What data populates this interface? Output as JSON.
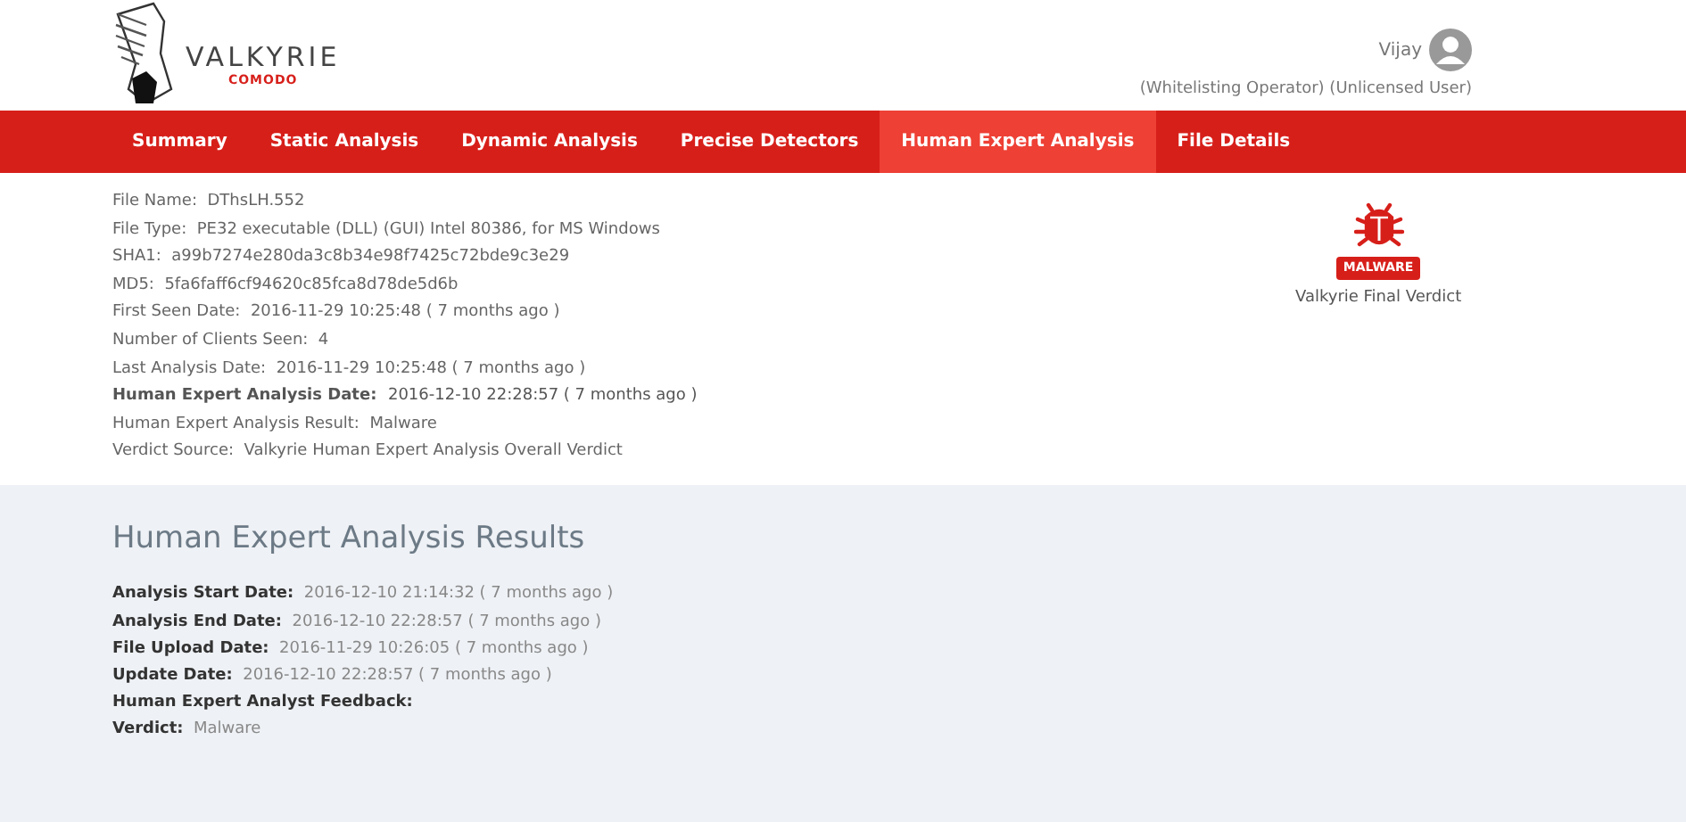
{
  "brand": {
    "name": "VALKYRIE",
    "sub": "COMODO"
  },
  "user": {
    "name": "Vijay",
    "roles": "(Whitelisting Operator) (Unlicensed User)"
  },
  "tabs": [
    {
      "label": "Summary",
      "selected": false
    },
    {
      "label": "Static Analysis",
      "selected": false
    },
    {
      "label": "Dynamic Analysis",
      "selected": false
    },
    {
      "label": "Precise Detectors",
      "selected": false
    },
    {
      "label": "Human Expert Analysis",
      "selected": true
    },
    {
      "label": "File Details",
      "selected": false
    }
  ],
  "file_info": [
    {
      "label": "File Name:",
      "value": "DThsLH.552",
      "emphasis": false
    },
    {
      "label": "File Type:",
      "value": "PE32 executable (DLL) (GUI) Intel 80386, for MS Windows",
      "emphasis": false
    },
    {
      "label": "SHA1:",
      "value": "a99b7274e280da3c8b34e98f7425c72bde9c3e29",
      "emphasis": false
    },
    {
      "label": "MD5:",
      "value": "5fa6faff6cf94620c85fca8d78de5d6b",
      "emphasis": false
    },
    {
      "label": "First Seen Date:",
      "value": "2016-11-29 10:25:48 ( 7 months ago )",
      "emphasis": false
    },
    {
      "label": "Number of Clients Seen:",
      "value": "4",
      "emphasis": false
    },
    {
      "label": "Last Analysis Date:",
      "value": "2016-11-29 10:25:48 ( 7 months ago )",
      "emphasis": false
    },
    {
      "label": "Human Expert Analysis Date:",
      "value": "2016-12-10 22:28:57 ( 7 months ago )",
      "emphasis": true
    },
    {
      "label": "Human Expert Analysis Result:",
      "value": "Malware",
      "emphasis": false
    },
    {
      "label": "Verdict Source:",
      "value": "Valkyrie Human Expert Analysis Overall Verdict",
      "emphasis": false
    }
  ],
  "verdict": {
    "badge": "MALWARE",
    "caption": "Valkyrie Final Verdict"
  },
  "results": {
    "title": "Human Expert Analysis Results",
    "rows": [
      {
        "label": "Analysis Start Date:",
        "value": "2016-12-10 21:14:32 ( 7 months ago )"
      },
      {
        "label": "Analysis End Date:",
        "value": "2016-12-10 22:28:57 ( 7 months ago )"
      },
      {
        "label": "File Upload Date:",
        "value": "2016-11-29 10:26:05 ( 7 months ago )"
      },
      {
        "label": "Update Date:",
        "value": "2016-12-10 22:28:57 ( 7 months ago )"
      },
      {
        "label": "Human Expert Analyst Feedback:"
      },
      {
        "label": "Verdict:",
        "value": "Malware"
      }
    ]
  }
}
